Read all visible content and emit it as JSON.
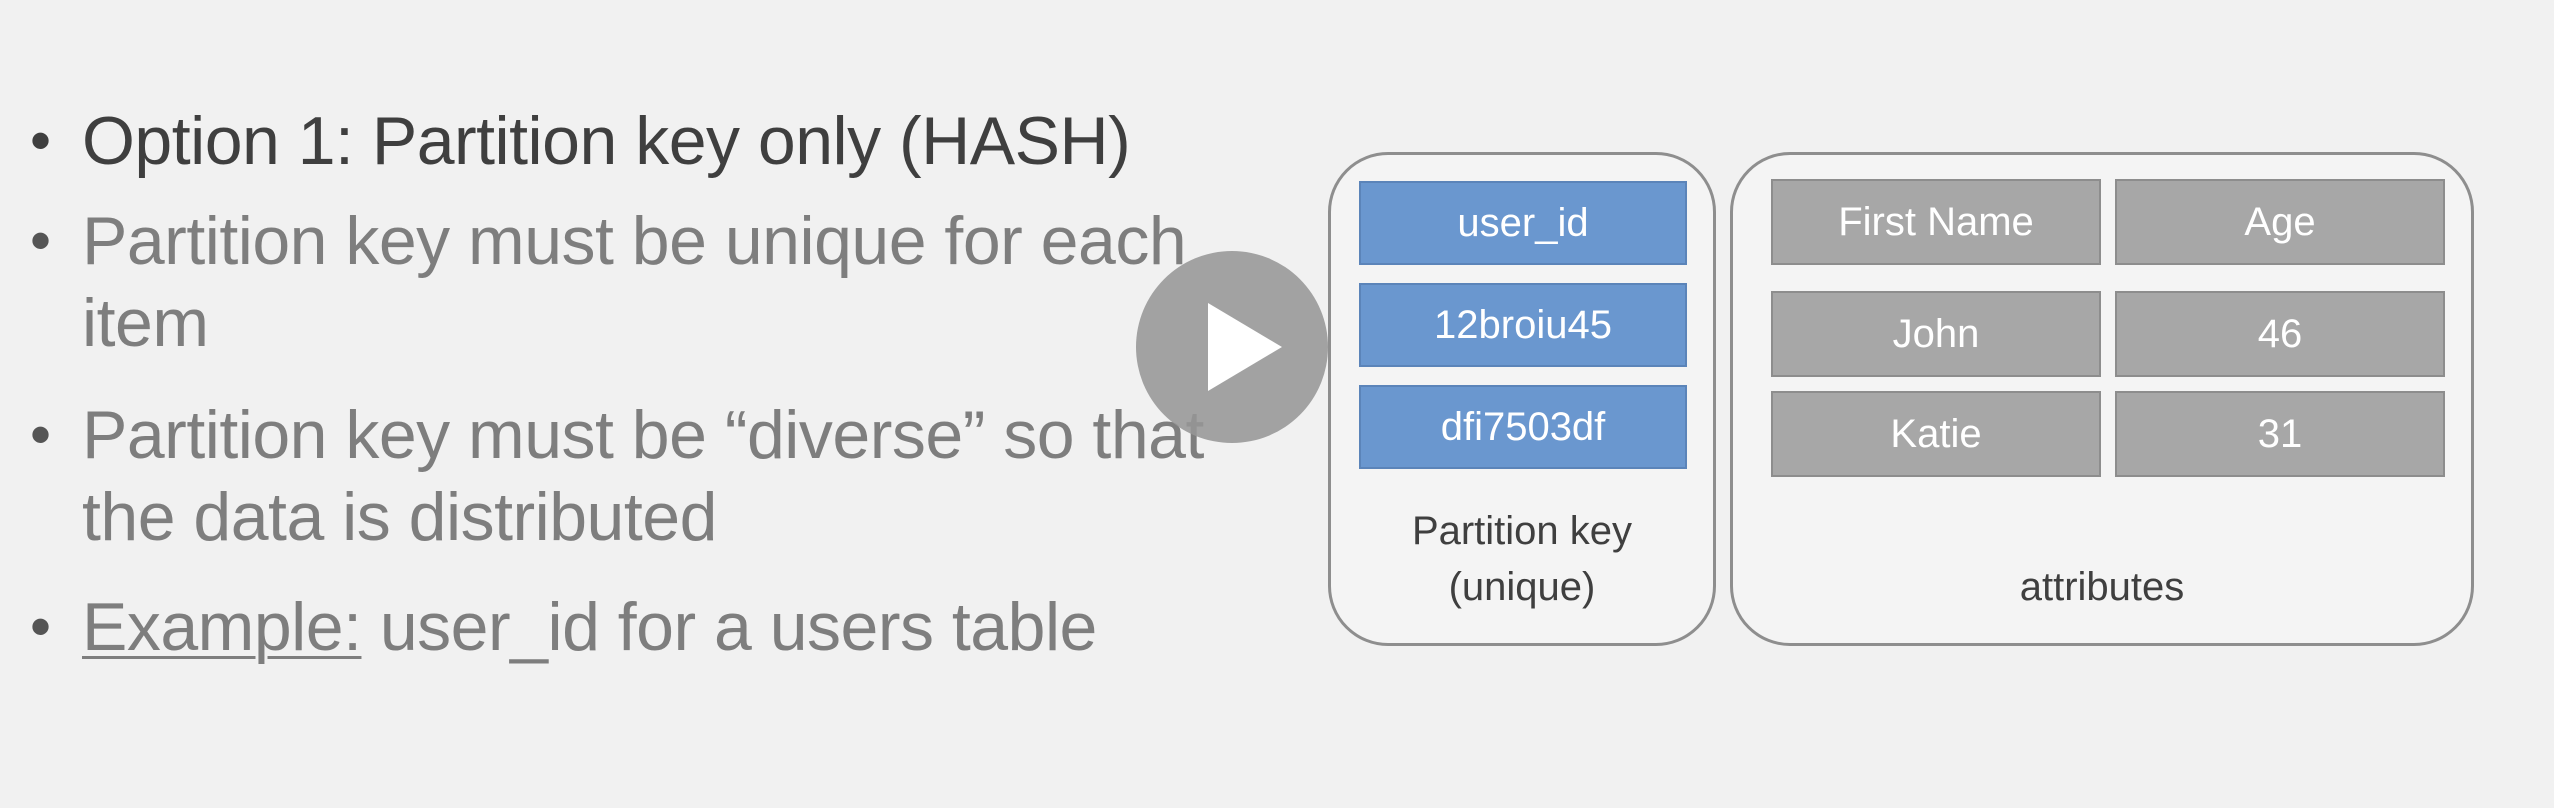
{
  "bullets": [
    {
      "text": "Option 1: Partition key only (HASH)"
    },
    {
      "text": "Partition key must be unique for each item"
    },
    {
      "text": "Partition key must be “diverse” so that the data is distributed"
    },
    {
      "label": "Example:",
      "text": " user_id for a users table"
    }
  ],
  "diagram": {
    "partition_key": {
      "cells": [
        "user_id",
        "12broiu45",
        "dfi7503df"
      ],
      "caption_line1": "Partition key",
      "caption_line2": "(unique)",
      "color": "#6a97cf"
    },
    "attributes": {
      "headers": [
        "First Name",
        "Age"
      ],
      "rows": [
        [
          "John",
          "46"
        ],
        [
          "Katie",
          "31"
        ]
      ],
      "caption": "attributes",
      "color": "#a7a7a7"
    }
  },
  "player": {
    "icon": "play-icon"
  }
}
